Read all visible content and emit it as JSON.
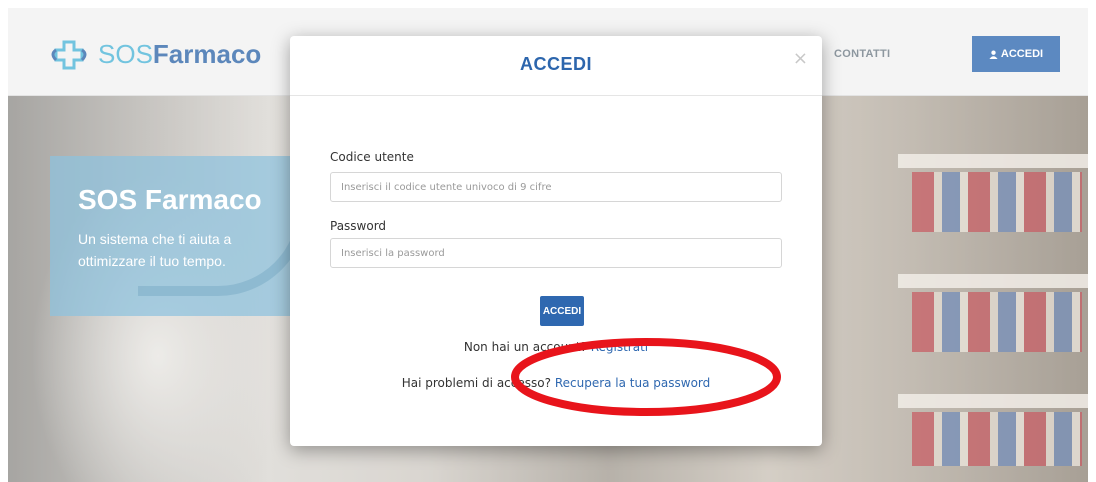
{
  "brand": {
    "logo_sos": "SOS",
    "logo_farmaco": "Farmaco",
    "logo_icon": "pharmacy-cross-icon"
  },
  "nav": {
    "contact_label": "CONTATTI",
    "login_label": "ACCEDI",
    "login_icon": "user-icon"
  },
  "hero": {
    "title": "SOS Farmaco",
    "subtitle": "Un sistema che ti aiuta a ottimizzare il tuo tempo."
  },
  "modal": {
    "title": "ACCEDI",
    "close_label": "×",
    "user_label": "Codice utente",
    "user_placeholder": "Inserisci il codice utente univoco di 9 cifre",
    "password_label": "Password",
    "password_placeholder": "Inserisci la password",
    "submit_label": "ACCEDI",
    "signup_prefix": "Non hai un account?",
    "signup_link": "Registrati",
    "recover_prefix": "Hai problemi di accesso?",
    "recover_link": "Recupera la tua password"
  },
  "annotation": {
    "color": "#e8141b"
  },
  "colors": {
    "primary": "#2f68b0",
    "accent_light": "#4bb4d6"
  }
}
